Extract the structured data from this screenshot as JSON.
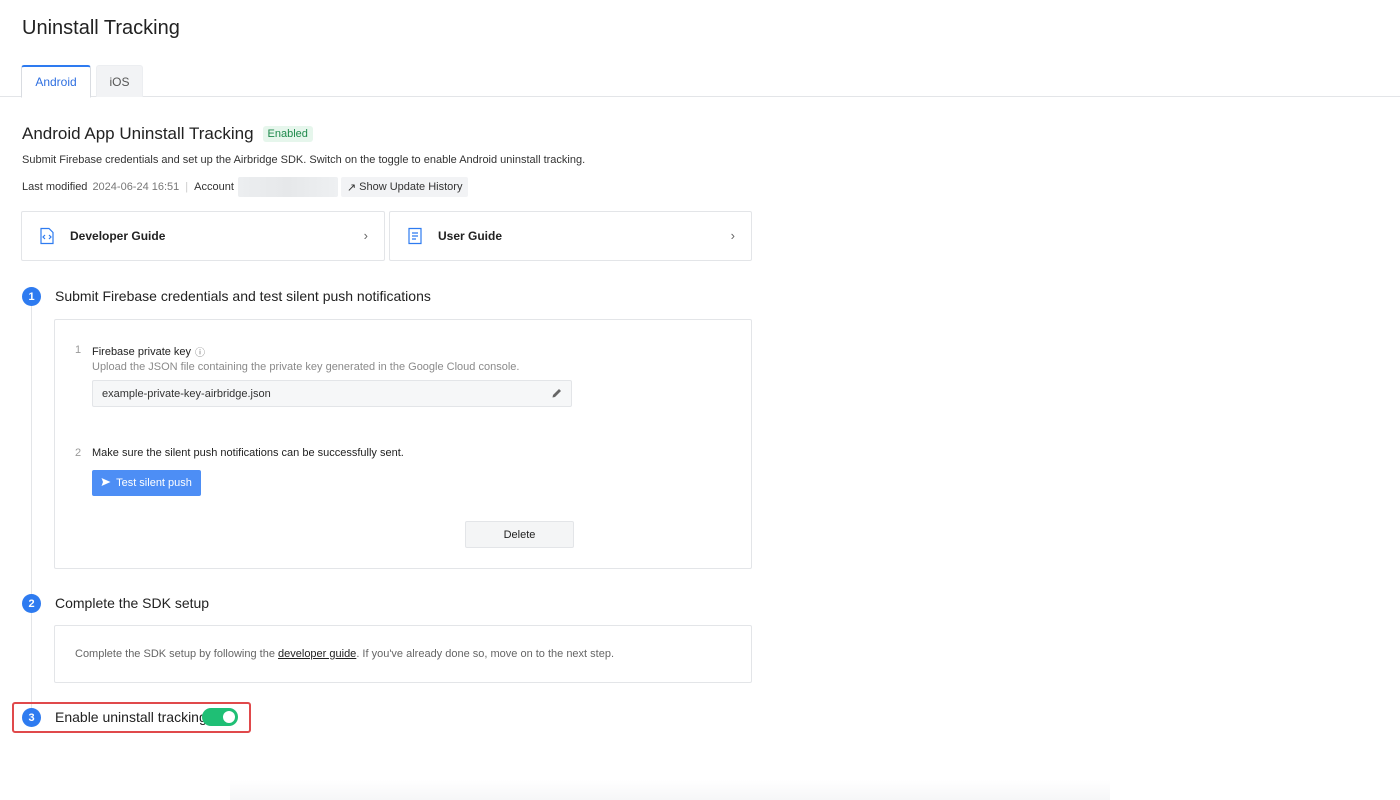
{
  "page": {
    "title": "Uninstall Tracking"
  },
  "tabs": [
    {
      "label": "Android",
      "active": true
    },
    {
      "label": "iOS",
      "active": false
    }
  ],
  "section": {
    "title": "Android App Uninstall Tracking",
    "status": "Enabled",
    "description": "Submit Firebase credentials and set up the Airbridge SDK. Switch on the toggle to enable Android uninstall tracking.",
    "last_modified_label": "Last modified",
    "last_modified_value": "2024-06-24 16:51",
    "account_label": "Account",
    "history_label": "Show Update History"
  },
  "guides": {
    "developer": "Developer Guide",
    "user": "User Guide"
  },
  "steps": {
    "step1": {
      "number": "1",
      "title": "Submit Firebase credentials and test silent push notifications",
      "item1": {
        "number": "1",
        "title": "Firebase private key",
        "description": "Upload the JSON file containing the private key generated in the Google Cloud console.",
        "file_value": "example-private-key-airbridge.json"
      },
      "item2": {
        "number": "2",
        "title": "Make sure the silent push notifications can be successfully sent.",
        "test_button": "Test silent push"
      },
      "delete_button": "Delete"
    },
    "step2": {
      "number": "2",
      "title": "Complete the SDK setup",
      "text_before": "Complete the SDK setup by following the ",
      "link": "developer guide",
      "text_after": ". If you've already done so, move on to the next step."
    },
    "step3": {
      "number": "3",
      "title": "Enable uninstall tracking",
      "toggle_on": true
    }
  },
  "colors": {
    "accent": "#2e7bf0",
    "button_primary": "#4d8ef5",
    "toggle_on": "#1fbf75",
    "highlight": "#e0494b",
    "badge_bg": "#e6f6ec",
    "badge_text": "#1f8a4c"
  },
  "icons": {
    "developer_guide": "code-file-icon",
    "user_guide": "document-lines-icon",
    "history": "arrow-up-right-icon",
    "help": "question-circle-icon",
    "edit": "pencil-icon",
    "send": "send-icon",
    "chevron": "chevron-right-icon"
  }
}
